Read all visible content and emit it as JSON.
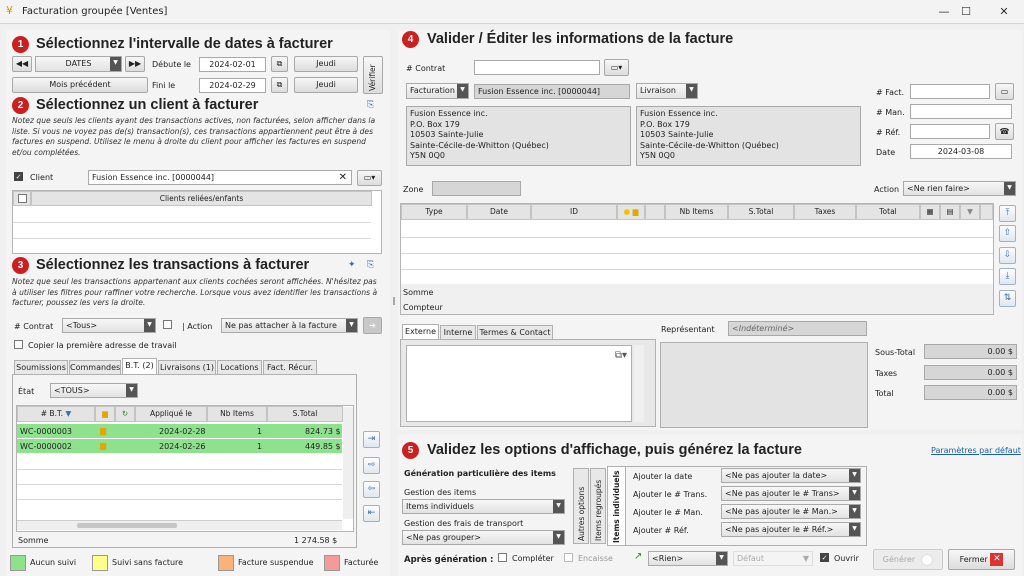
{
  "window": {
    "title": "Facturation groupée [Ventes]"
  },
  "s1": {
    "num": "1",
    "title": "Sélectionnez l'intervalle de dates à facturer",
    "dates_btn": "DATES",
    "start_label": "Débute le",
    "start_date": "2024-02-01",
    "start_day": "Jeudi",
    "prev_month": "Mois précédent",
    "end_label": "Fini le",
    "end_date": "2024-02-29",
    "end_day": "Jeudi",
    "verify": "Vérifier"
  },
  "s2": {
    "num": "2",
    "title": "Sélectionnez un client à facturer",
    "note": "Notez que seuls les clients ayant des transactions actives, non facturées, selon afficher dans la liste. Si vous ne voyez pas de(s) transaction(s), ces transactions appartiennent peut être à des factures en suspend. Utilisez le menu à droite du client pour afficher les factures en suspend et/ou complétées.",
    "client_label": "Client",
    "client_value": "Fusion Essence inc. [0000044]",
    "col_children": "Clients reliées/enfants"
  },
  "s3": {
    "num": "3",
    "title": "Sélectionnez les transactions à facturer",
    "note": "Notez que seul les transactions appartenant aux clients cochées seront affichées. N'hésitez pas à utiliser les filtres pour raffiner votre recherche. Lorsque vous avez identifier les transactions à facturer, poussez les vers la droite.",
    "contract_label": "# Contrat",
    "contract_value": "<Tous>",
    "action_label": "| Action",
    "action_value": "Ne pas attacher à la facture",
    "copy_label": "Copier la première adresse de travail",
    "tabs": [
      "Soumissions",
      "Commandes",
      "B.T. (2)",
      "Livraisons (1)",
      "Locations",
      "Fact. Récur."
    ],
    "state_label": "État",
    "state_value": "<TOUS>",
    "cols": [
      "# B.T.",
      "",
      "",
      "Appliqué le",
      "Nb Items",
      "S.Total"
    ],
    "rows": [
      {
        "id": "WC-0000003",
        "date": "2024-02-28",
        "items": "1",
        "total": "824.73 $"
      },
      {
        "id": "WC-0000002",
        "date": "2024-02-26",
        "items": "1",
        "total": "449.85 $"
      }
    ],
    "sum_label": "Somme",
    "sum_value": "1 274.58 $"
  },
  "legend": [
    "Aucun suivi",
    "Suivi sans facture",
    "Facture suspendue",
    "Facturée"
  ],
  "s4": {
    "num": "4",
    "title": "Valider / Éditer les informations de la facture",
    "contract_label": "# Contrat",
    "billing": "Facturation",
    "billing_name": "Fusion Essence inc. [0000044]",
    "delivery": "Livraison",
    "billing_addr": [
      "Fusion Essence inc.",
      "P.O. Box 179",
      "10503 Sainte-Julie",
      "Sainte-Cécile-de-Whitton (Québec)",
      "Y5N 0Q0"
    ],
    "delivery_addr": [
      "Fusion Essence inc.",
      "P.O. Box 179",
      "10503 Sainte-Julie",
      "Sainte-Cécile-de-Whitton (Québec)",
      "Y5N 0Q0"
    ],
    "fact_label": "# Fact.",
    "man_label": "# Man.",
    "ref_label": "# Réf.",
    "date_label": "Date",
    "date_value": "2024-03-08",
    "zone_label": "Zone",
    "action_label": "Action",
    "action_value": "<Ne rien faire>",
    "cols": [
      "Type",
      "Date",
      "ID",
      "",
      "",
      "Nb Items",
      "S.Total",
      "Taxes",
      "Total"
    ],
    "somme": "Somme",
    "compteur": "Compteur",
    "tabs": [
      "Externe",
      "Interne",
      "Termes & Contact"
    ],
    "rep_label": "Représentant",
    "rep_value": "<Indéterminé>",
    "subtotal_label": "Sous-Total",
    "subtotal": "0.00 $",
    "taxes_label": "Taxes",
    "taxes": "0.00 $",
    "total_label": "Total",
    "total": "0.00 $"
  },
  "s5": {
    "num": "5",
    "title": "Validez les options d'affichage, puis générez la facture",
    "defaults_link": "Paramètres par défaut",
    "gen_title": "Génération particulière des items",
    "items_mgmt_label": "Gestion des items",
    "items_mgmt_value": "Items individuels",
    "shipping_label": "Gestion des frais de transport",
    "shipping_value": "<Ne pas grouper>",
    "vtabs": [
      "Autres options",
      "Items regroupés",
      "Items individuels"
    ],
    "opts": [
      {
        "label": "Ajouter la date",
        "value": "<Ne pas ajouter la date>"
      },
      {
        "label": "Ajouter le # Trans.",
        "value": "<Ne pas ajouter le # Trans>"
      },
      {
        "label": "Ajouter le # Man.",
        "value": "<Ne pas ajouter le # Man.>"
      },
      {
        "label": "Ajouter # Réf.",
        "value": "<Ne pas ajouter le # Réf.>"
      }
    ],
    "after_label": "Après génération :",
    "complete": "Compléter",
    "cash": "Encaisse",
    "rien": "<Rien>",
    "defaut": "Défaut",
    "open": "Ouvrir",
    "generate": "Générer",
    "close": "Fermer"
  }
}
